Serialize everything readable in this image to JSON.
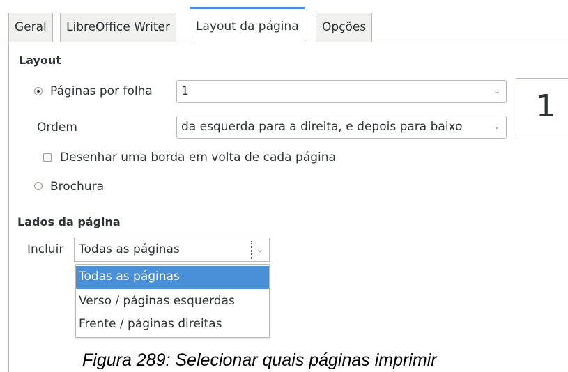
{
  "tabs": [
    {
      "label": "Geral",
      "active": false
    },
    {
      "label": "LibreOffice Writer",
      "active": false
    },
    {
      "label": "Layout da página",
      "active": true
    },
    {
      "label": "Opções",
      "active": false
    }
  ],
  "layout": {
    "heading": "Layout",
    "pages_per_sheet_label": "Páginas por folha",
    "pages_per_sheet_value": "1",
    "order_label": "Ordem",
    "order_value": "da esquerda para a direita, e depois para baixo",
    "border_checkbox_label": "Desenhar uma borda em volta de cada página",
    "border_checked": false,
    "brochure_label": "Brochura",
    "selected_mode": "pages_per_sheet",
    "preview_number": "1"
  },
  "page_sides": {
    "heading": "Lados da página",
    "include_label": "Incluir",
    "include_value": "Todas as páginas",
    "options": [
      "Todas as páginas",
      "Verso / páginas esquerdas",
      "Frente / páginas direitas"
    ],
    "selected_index": 0
  },
  "caption": "Figura 289: Selecionar quais páginas imprimir",
  "colors": {
    "accent": "#4a90d9"
  }
}
